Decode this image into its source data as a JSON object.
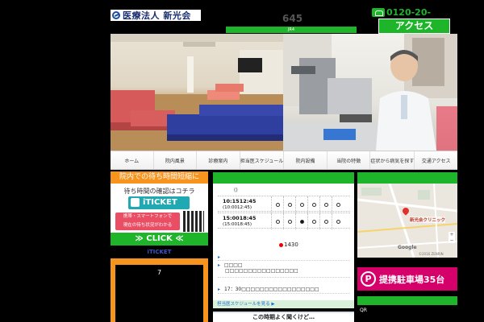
{
  "header": {
    "logo_text": "医療法人 新光会",
    "counter": "645",
    "green_bar_text": "JR4",
    "phone": "0120-20-",
    "access_label": "アクセス"
  },
  "nav": {
    "items": [
      "ホーム",
      "院内風景",
      "診療案内",
      "担当医スケジュール",
      "院内設備",
      "当院の特徴",
      "症状から病気を探す",
      "交通アクセス"
    ]
  },
  "iticket": {
    "heading": "院内での待ち時間短縮に",
    "sub": "待ち時間の確認はコチラ",
    "logo": "iTICKET",
    "note_line1": "携帯・スマートフォンで",
    "note_line2": "現在の待ち状況がわかる",
    "click_label": "≫ CLICK ≪",
    "link_label": "iTICKET",
    "orange_number": "7"
  },
  "schedule": {
    "paren": "()",
    "rows": [
      {
        "time": "10:1512:45",
        "sub": "(10:0012:45)",
        "dots": [
          "empty",
          "empty",
          "empty",
          "empty",
          "empty",
          "empty"
        ]
      },
      {
        "time": "15:0018:45",
        "sub": "(15:0018:45)",
        "dots": [
          "empty",
          "empty",
          "filled",
          "empty",
          "empty",
          "empty"
        ]
      }
    ],
    "red_note": "1430",
    "news": [
      {
        "title": "",
        "body": ""
      },
      {
        "title": "□□□□",
        "body": "□□□□□□□□□□□□□□□□"
      },
      {
        "title": "",
        "body": "17：30□□□□□□□□□□□□□□□□□"
      }
    ],
    "link": "担当医スケジュールを見る ▶",
    "banner": "この時期よく聞くけど…"
  },
  "map": {
    "label": "新光会クリニック",
    "google": "Google",
    "credit": "©2016 ZENRIN",
    "zoom_in": "+",
    "zoom_out": "−"
  },
  "parking": {
    "mark": "P",
    "text": "提携駐車場35台"
  },
  "qr_label": "QR"
}
